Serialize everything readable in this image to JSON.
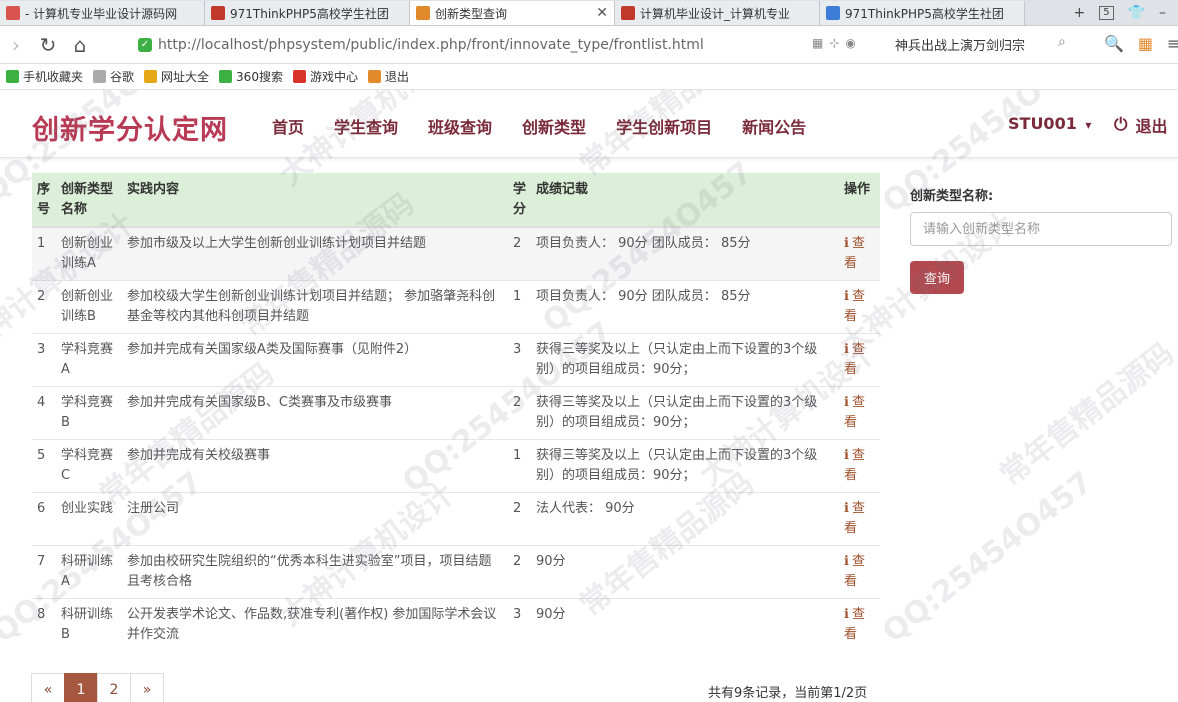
{
  "browser": {
    "tabs": [
      {
        "label": "- 计算机专业毕业设计源码网",
        "icon": "page-icon",
        "color": "#d9534f",
        "active": false
      },
      {
        "label": "971ThinkPHP5高校学生社团",
        "icon": "red-square-icon",
        "color": "#c0392b",
        "active": false
      },
      {
        "label": "创新类型查询",
        "icon": "orange-box-icon",
        "color": "#e08a2c",
        "active": true,
        "close": "✕"
      },
      {
        "label": "计算机毕业设计_计算机专业",
        "icon": "red-square-icon",
        "color": "#c0392b",
        "active": false
      },
      {
        "label": "971ThinkPHP5高校学生社团",
        "icon": "paw-icon",
        "color": "#3b7dd8",
        "active": false
      }
    ],
    "new_tab": "+",
    "tab_count": "5",
    "url": "http://localhost/phpsystem/public/index.php/front/innovate_type/frontlist.html",
    "search_suggestion": "神兵出战上演万剑归宗"
  },
  "bookmarks": [
    {
      "label": "手机收藏夹",
      "icon": "phone-icon",
      "color": "#3cb043"
    },
    {
      "label": "谷歌",
      "icon": "doc-icon",
      "color": "#aaaaaa"
    },
    {
      "label": "网址大全",
      "icon": "globe-icon",
      "color": "#e6a817"
    },
    {
      "label": "360搜索",
      "icon": "360-icon",
      "color": "#3cb043"
    },
    {
      "label": "游戏中心",
      "icon": "game-icon",
      "color": "#d9342b"
    },
    {
      "label": "退出",
      "icon": "exit-icon",
      "color": "#e08a2c"
    }
  ],
  "site": {
    "brand": "创新学分认定网",
    "menu": [
      "首页",
      "学生查询",
      "班级查询",
      "创新类型",
      "学生创新项目",
      "新闻公告"
    ],
    "user": "STU001",
    "user_caret": "▾",
    "logout": "退出",
    "brand_color": "#b93a55"
  },
  "table": {
    "headers": [
      "序号",
      "创新类型名称",
      "实践内容",
      "学分",
      "成绩记载",
      "操作"
    ],
    "rows": [
      {
        "no": "1",
        "type": "创新创业训练A",
        "content": "参加市级及以上大学生创新创业训练计划项目并结题",
        "credit": "2",
        "score": "项目负责人： 90分 团队成员： 85分",
        "op": "查看"
      },
      {
        "no": "2",
        "type": "创新创业训练B",
        "content": "参加校级大学生创新创业训练计划项目并结题； 参加骆肇尧科创基金等校内其他科创项目并结题",
        "credit": "1",
        "score": "项目负责人： 90分 团队成员： 85分",
        "op": "查看"
      },
      {
        "no": "3",
        "type": "学科竞赛A",
        "content": "参加并完成有关国家级A类及国际赛事（见附件2）",
        "credit": "3",
        "score": "获得三等奖及以上（只认定由上而下设置的3个级别）的项目组成员：90分；",
        "op": "查看"
      },
      {
        "no": "4",
        "type": "学科竞赛B",
        "content": "参加并完成有关国家级B、C类赛事及市级赛事",
        "credit": "2",
        "score": "获得三等奖及以上（只认定由上而下设置的3个级别）的项目组成员：90分；",
        "op": "查看"
      },
      {
        "no": "5",
        "type": "学科竞赛C",
        "content": "参加并完成有关校级赛事",
        "credit": "1",
        "score": "获得三等奖及以上（只认定由上而下设置的3个级别）的项目组成员：90分；",
        "op": "查看"
      },
      {
        "no": "6",
        "type": "创业实践",
        "content": "注册公司",
        "credit": "2",
        "score": "法人代表： 90分",
        "op": "查看"
      },
      {
        "no": "7",
        "type": "科研训练A",
        "content": "参加由校研究生院组织的“优秀本科生进实验室”项目，项目结题且考核合格",
        "credit": "2",
        "score": "90分",
        "op": "查看"
      },
      {
        "no": "8",
        "type": "科研训练B",
        "content": "公开发表学术论文、作品数,获准专利(著作权) 参加国际学术会议并作交流",
        "credit": "3",
        "score": "90分",
        "op": "查看"
      }
    ],
    "header_bg": "#dcefd8",
    "op_color": "#a0522d"
  },
  "pagination": {
    "prev": "«",
    "pages": [
      "1",
      "2"
    ],
    "current": "1",
    "next": "»",
    "info": "共有9条记录，当前第1/2页"
  },
  "side_search": {
    "label": "创新类型名称:",
    "placeholder": "请输入创新类型名称",
    "value": "",
    "button": "查询",
    "button_color": "#b2494e"
  },
  "watermark": {
    "texts": [
      "QQ:25454O457",
      "大神计算机设计",
      "常年售精品源码"
    ]
  }
}
